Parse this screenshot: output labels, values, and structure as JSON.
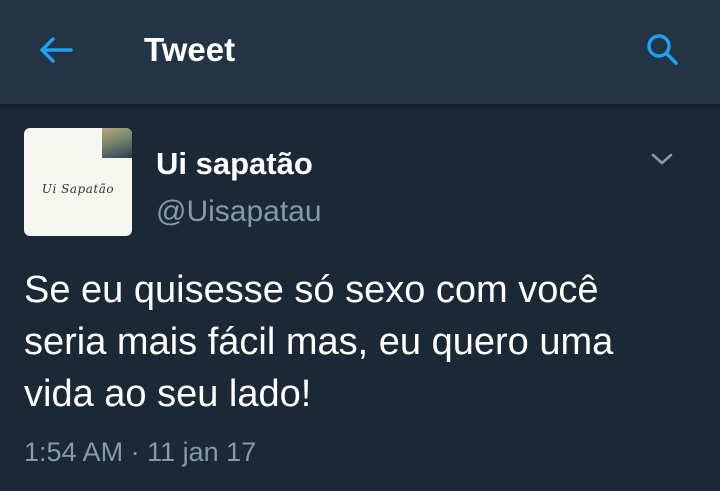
{
  "header": {
    "title": "Tweet",
    "back_icon": "arrow-left-icon",
    "search_icon": "search-icon",
    "accent_color": "#1da1f2"
  },
  "tweet": {
    "avatar_text": "Ui Sapatão",
    "author_name": "Ui sapatão",
    "author_handle": "@Uisapatau",
    "menu_icon": "chevron-down-icon",
    "text_lines": [
      "Se eu quisesse só sexo com você",
      "seria mais fácil mas, eu quero uma",
      "vida ao seu lado!"
    ],
    "time": "1:54 AM",
    "separator": "·",
    "date": "11 jan 17"
  }
}
